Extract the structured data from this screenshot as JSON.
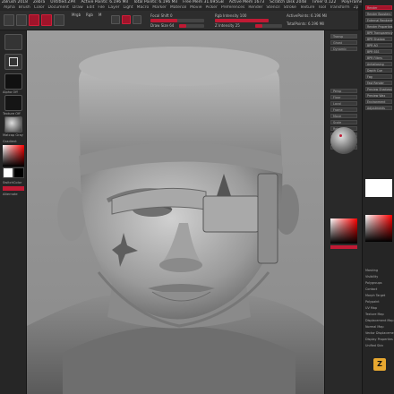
{
  "titlebar": {
    "items": [
      "ZBrush 2018",
      "Zebra",
      "Untitled.ZPR",
      "Active Points: 6.196 Mil",
      "Total Points: 6.196 Mil",
      "Free Mem 31.695GB",
      "Active Mem 1673",
      "Scratch Disk 2048",
      "Timer 0.122",
      "PolyFrame 0.016",
      "ATime 0.042",
      "QuickSave"
    ]
  },
  "menubar": {
    "items": [
      "Alpha",
      "Brush",
      "Color",
      "Document",
      "Draw",
      "Edit",
      "File",
      "Layer",
      "Light",
      "Macro",
      "Marker",
      "Material",
      "Movie",
      "Picker",
      "Preferences",
      "Render",
      "Stencil",
      "Stroke",
      "Texture",
      "Tool",
      "Transform",
      "Zplugin",
      "Zscript",
      "Help"
    ]
  },
  "toolbar": {
    "mrgb_label": "Mrgb",
    "rgb_label": "Rgb",
    "m_label": "M",
    "zadd_label": "Zadd",
    "zsub_label": "Zsub",
    "zcut_label": "Zcut",
    "focal_label": "Focal Shift 0",
    "rgb_intensity_label": "Rgb Intensity 100",
    "z_intensity_label": "Z Intensity 25",
    "draw_size_label": "Draw Size 64",
    "dynamic_label": "Dynamic",
    "active_points_label": "ActivePoints: 6.196 Mil",
    "total_points_label": "TotalPoints: 6.196 Mil",
    "rgb_intensity": 1.0,
    "z_intensity": 0.25
  },
  "left_tray": {
    "items": [
      "Alpha Off",
      "Texture Off",
      "Matcap Gray",
      "Gradient",
      "SwitchColor",
      "Alternate"
    ],
    "colors": {
      "main": "#ffffff",
      "secondary": "#000000",
      "accent": "#c01a34"
    }
  },
  "right_tray": {
    "items": [
      "Transp",
      "Ghost",
      "Dynamic",
      "Persp",
      "Floor",
      "Local",
      "Frame",
      "Move",
      "Scale",
      "Rotate",
      "PolyF",
      "Solo",
      "Xpose"
    ],
    "accent": "#c01a34"
  },
  "right_panel": {
    "items": [
      "Render",
      "Render Boosters",
      "External Renderer",
      "Render Properties",
      "BPR Transparency",
      "BPR Shadow",
      "BPR AO",
      "BPR SSS",
      "BPR Filters",
      "Antialiasing",
      "Depth Cue",
      "Fog",
      "Fast Render",
      "Preview Shadows",
      "Preview Wax",
      "Environment",
      "Adjustments"
    ],
    "bottom_items": [
      "Masking",
      "Visibility",
      "Polygroups",
      "Contact",
      "Morph Target",
      "Polypaint",
      "UV Map",
      "Texture Map",
      "Displacement Map",
      "Normal Map",
      "Vector Displacement Map",
      "Display Properties",
      "Unified Skin"
    ],
    "icon": "zbrush-logo-icon"
  }
}
